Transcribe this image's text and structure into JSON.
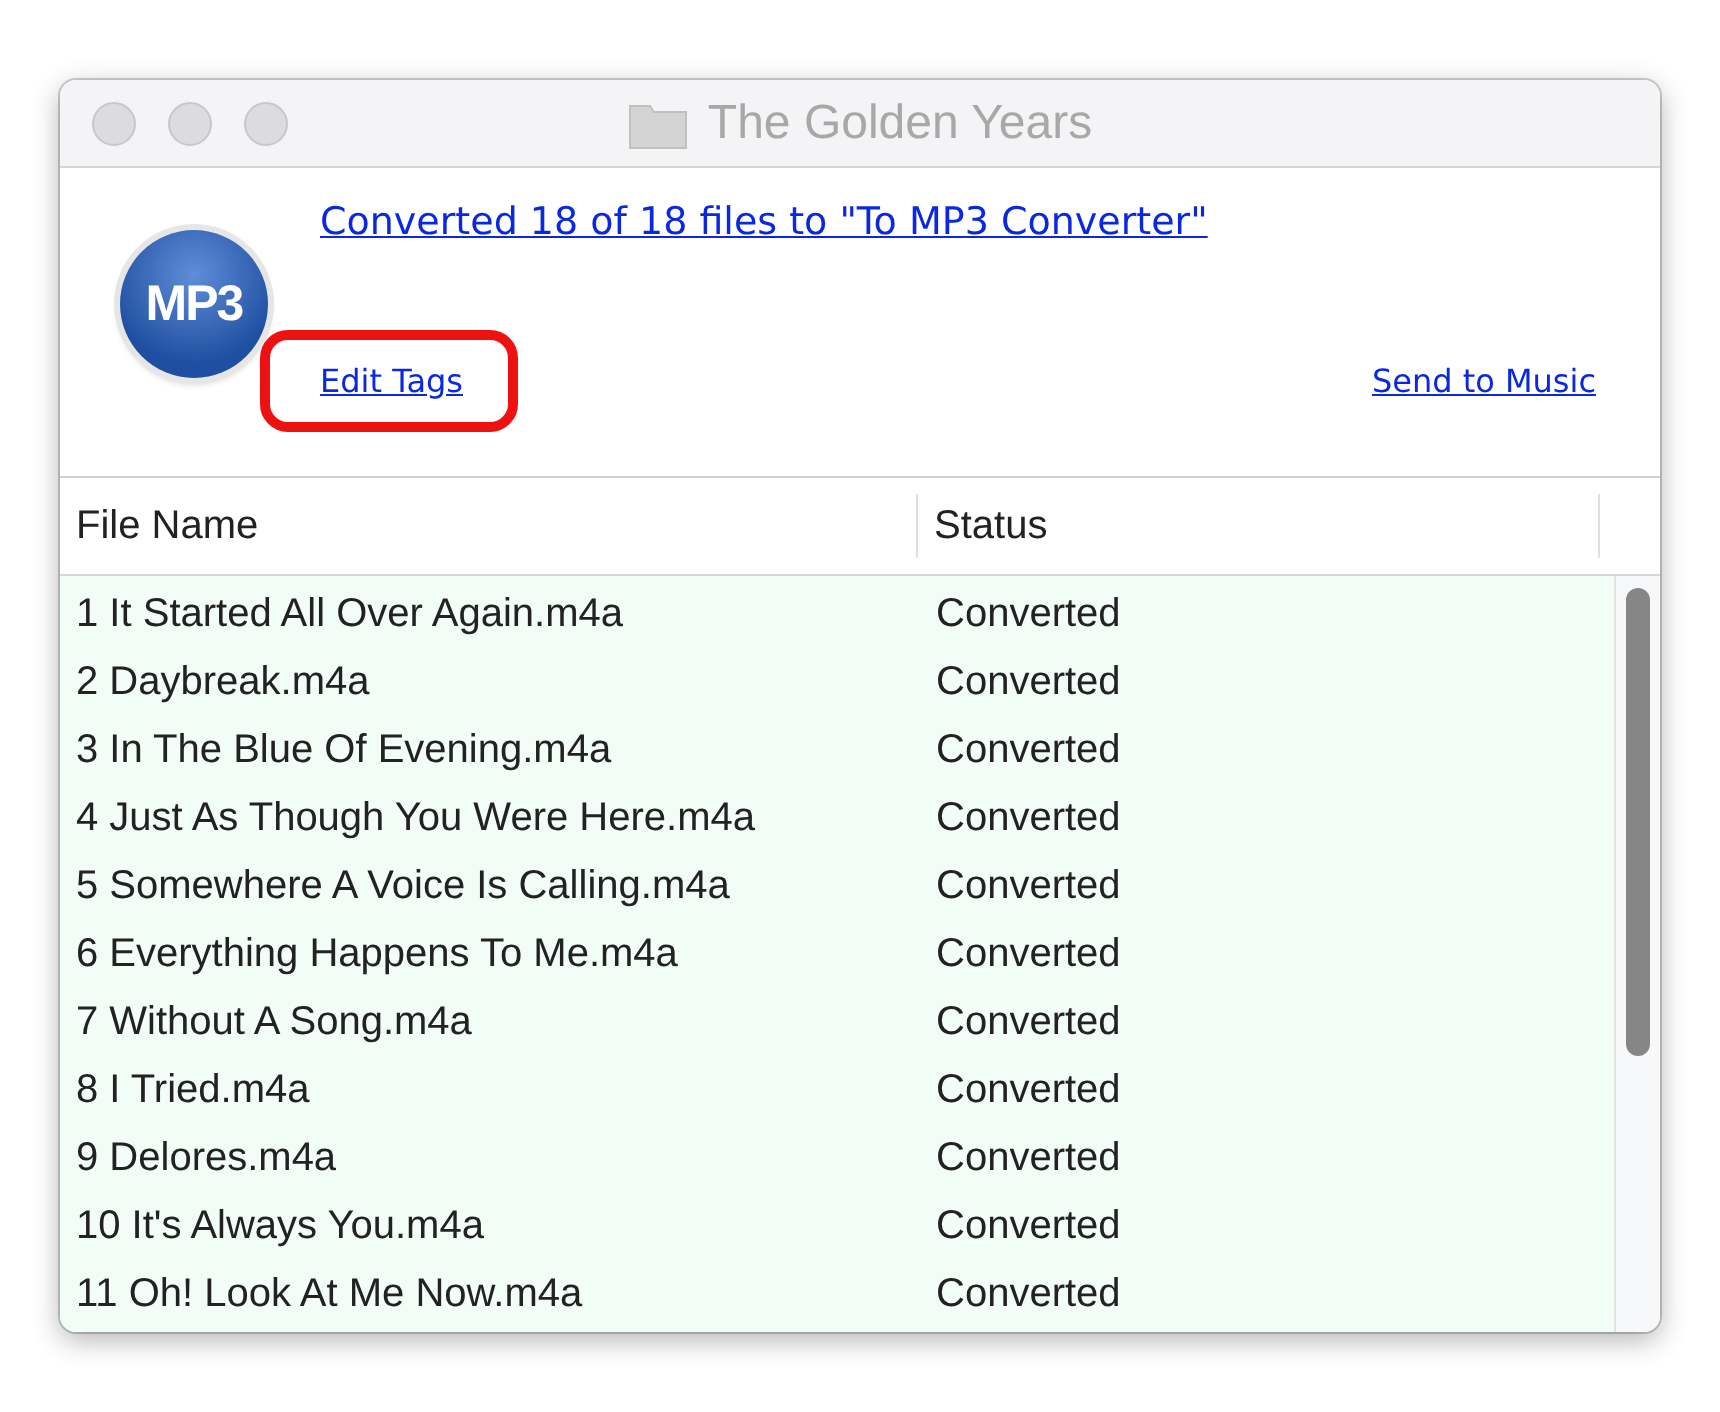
{
  "window": {
    "title": "The Golden Years"
  },
  "header": {
    "logo_text": "MP3",
    "summary_link": "Converted 18 of 18 files to \"To MP3 Converter\"",
    "edit_tags_link": "Edit Tags",
    "edit_tags_highlighted": true,
    "send_link": "Send to Music"
  },
  "table": {
    "columns": [
      "File Name",
      "Status"
    ],
    "rows": [
      {
        "file": "1 It Started All Over Again.m4a",
        "status": "Converted"
      },
      {
        "file": "2 Daybreak.m4a",
        "status": "Converted"
      },
      {
        "file": "3 In The Blue Of Evening.m4a",
        "status": "Converted"
      },
      {
        "file": "4 Just As Though You Were Here.m4a",
        "status": "Converted"
      },
      {
        "file": "5 Somewhere A Voice Is Calling.m4a",
        "status": "Converted"
      },
      {
        "file": "6 Everything Happens To Me.m4a",
        "status": "Converted"
      },
      {
        "file": "7 Without A Song.m4a",
        "status": "Converted"
      },
      {
        "file": "8 I Tried.m4a",
        "status": "Converted"
      },
      {
        "file": "9 Delores.m4a",
        "status": "Converted"
      },
      {
        "file": "10 It's Always You.m4a",
        "status": "Converted"
      },
      {
        "file": "11 Oh! Look At Me Now.m4a",
        "status": "Converted"
      }
    ]
  }
}
